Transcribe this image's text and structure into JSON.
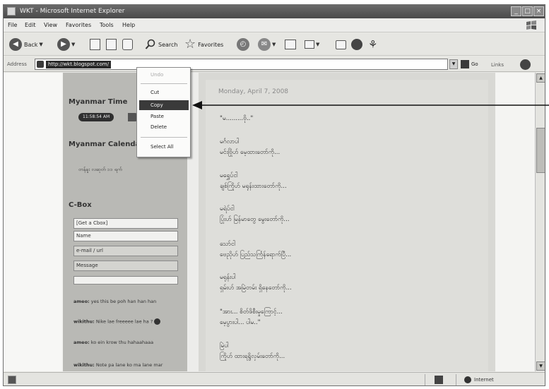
{
  "window": {
    "title": "WKT - Microsoft Internet Explorer",
    "controls": [
      "_",
      "□",
      "×"
    ]
  },
  "menubar": {
    "items": [
      "File",
      "Edit",
      "View",
      "Favorites",
      "Tools",
      "Help"
    ]
  },
  "toolbar": {
    "back_label": "Back",
    "search_label": "Search",
    "favorites_label": "Favorites",
    "icons": [
      "back-arrow-icon",
      "forward-arrow-icon",
      "stop-icon",
      "refresh-icon",
      "home-icon",
      "search-icon",
      "favorites-star-icon",
      "history-icon",
      "mail-icon",
      "print-icon",
      "edit-icon",
      "discuss-icon",
      "messenger-icon"
    ]
  },
  "addressbar": {
    "label": "Address",
    "url": "http://wkt.blogspot.com/",
    "go_label": "Go",
    "links_label": "Links"
  },
  "sidebar": {
    "time_title": "Myanmar Time",
    "time_value": "11:58:54 AM",
    "calendar_title": "Myanmar Calendar",
    "calendar_text": "တန်ခူး လဆုတ် ၁၁ ရက်",
    "cbox_title": "C-Box",
    "cbox_fields": [
      "[Get a Cbox]",
      "Name",
      "e-mail / url",
      "Message"
    ],
    "chat": [
      {
        "user": "ameo:",
        "text": "yes this be poh han han han"
      },
      {
        "user": "wikithu:",
        "text": "Nike lae freeeee lae ha ?"
      },
      {
        "user": "ameo:",
        "text": "ko ein krow thu hahaahaaa"
      },
      {
        "user": "wikithu:",
        "text": "Note pa lane ko ma lane mar"
      }
    ]
  },
  "post": {
    "date": "Monday, April 7, 2008",
    "lines": [
      "\"မ.........ဗို..\"",
      "မင်္ဂလာပါ",
      "မင်းဗြိုဟ် မေ့ထားတော်ကို...",
      "မရွှေပ်ငါ",
      "ချစ်ကြိုဟ် မရုန်းထားတော်ကို...",
      "မရဲပ်ငါ",
      "ပြုံးဟ် မြန်မာတွေ မွေးတော်ကို...",
      "သော်ငါ",
      "ဗေညိုဟ် ပြည်သင်္ကြန်ရောက်ပြီ...",
      "မရုန်းပါ",
      "ရှမ်းဟ် အမြဲတမ်း ရှိနေတော်ကို...",
      "\"အား... စိတ်ဖိစီးမှုကြောင့်...",
      "မေ့ပွားပါ... ပါမ..\"",
      "မြဲပါ",
      "ကြိုဟ် ထားရရွိလှမ်းတော်ကို..."
    ]
  },
  "context_menu": {
    "items": [
      {
        "label": "Undo",
        "disabled": true
      },
      {
        "label": "Cut",
        "disabled": false
      },
      {
        "label": "Copy",
        "disabled": false,
        "selected": true
      },
      {
        "label": "Paste",
        "disabled": false
      },
      {
        "label": "Delete",
        "disabled": false
      },
      {
        "label": "Select All",
        "disabled": false
      }
    ]
  },
  "statusbar": {
    "zone": "Internet"
  },
  "colors": {
    "titlebar": "#555555",
    "selection": "#3a3a3a",
    "sidebar": "#b9b9b5",
    "post_bg": "#dededa"
  }
}
